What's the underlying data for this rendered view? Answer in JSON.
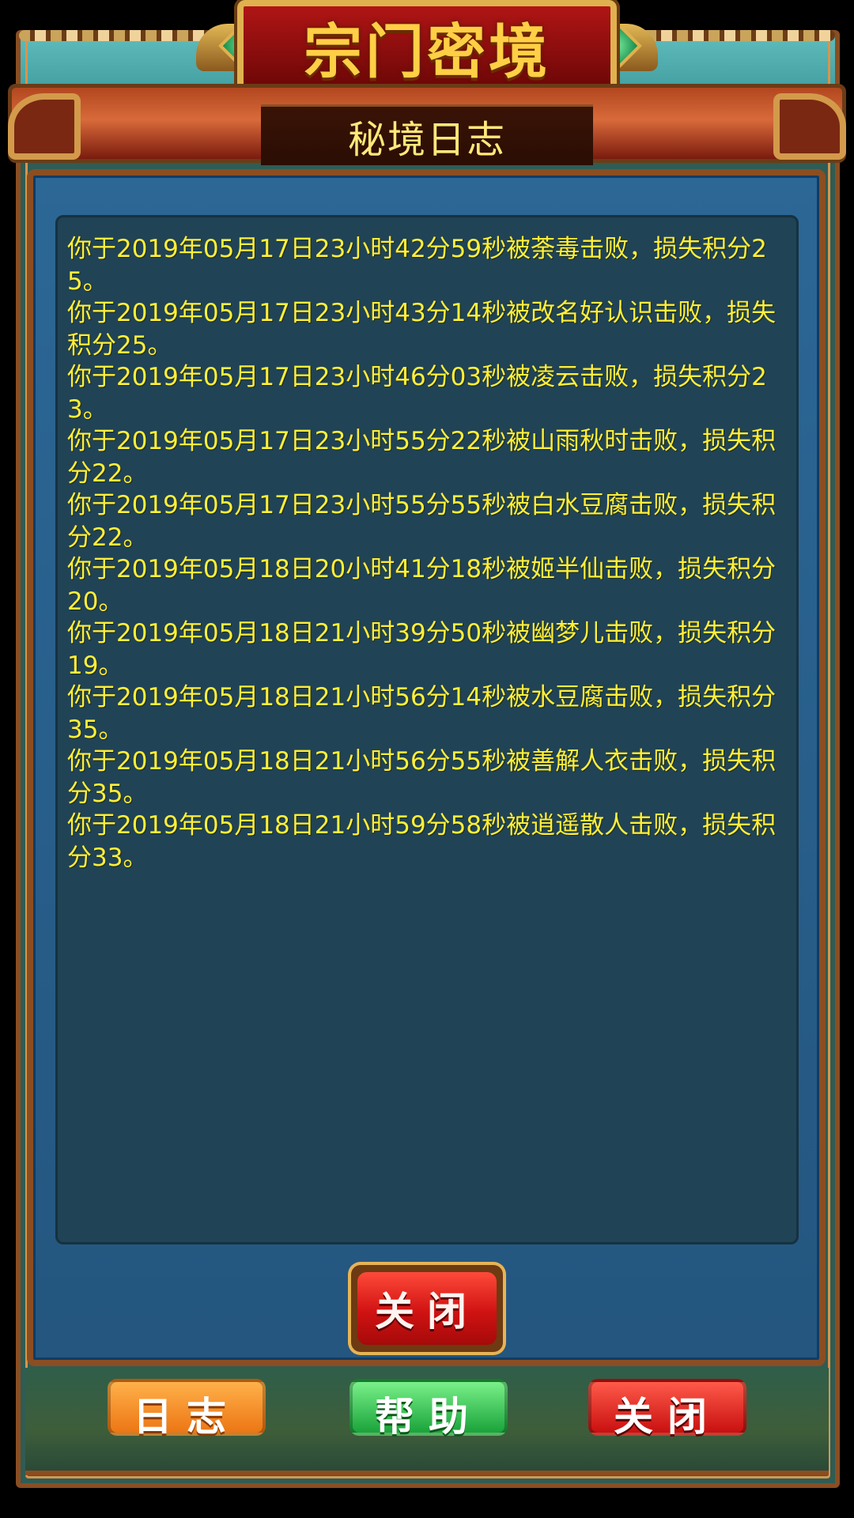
{
  "header": {
    "title": "宗门密境",
    "subtitle": "秘境日志"
  },
  "log": {
    "entries": [
      "你于2019年05月17日23小时42分59秒被荼毒击败，损失积分25。",
      "你于2019年05月17日23小时43分14秒被改名好认识击败，损失积分25。",
      "你于2019年05月17日23小时46分03秒被凌云击败，损失积分23。",
      "你于2019年05月17日23小时55分22秒被山雨秋时击败，损失积分22。",
      "你于2019年05月17日23小时55分55秒被白水豆腐击败，损失积分22。",
      "你于2019年05月18日20小时41分18秒被姬半仙击败，损失积分20。",
      "你于2019年05月18日21小时39分50秒被幽梦儿击败，损失积分19。",
      "你于2019年05月18日21小时56分14秒被水豆腐击败，损失积分35。",
      "你于2019年05月18日21小时56分55秒被善解人衣击败，损失积分35。",
      "你于2019年05月18日21小时59分58秒被逍遥散人击败，损失积分33。"
    ]
  },
  "dialog": {
    "close_label": "关闭"
  },
  "bottom_buttons": {
    "log_label": "日志",
    "help_label": "帮助",
    "close_label": "关闭"
  }
}
